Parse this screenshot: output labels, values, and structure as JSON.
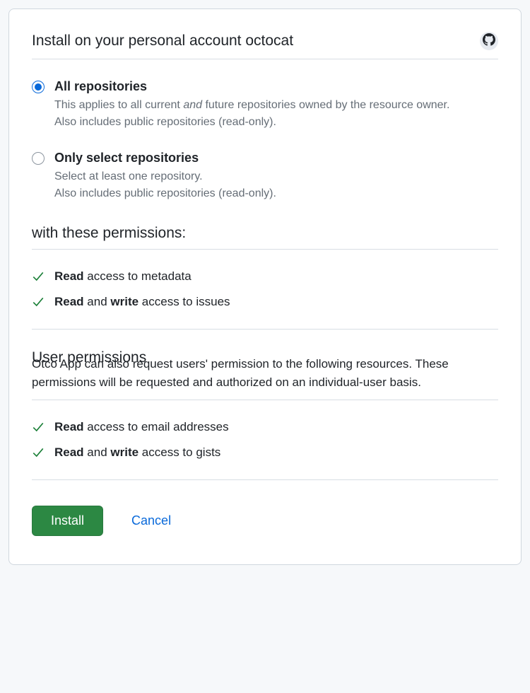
{
  "header": {
    "title": "Install on your personal account octocat"
  },
  "repo_selection": {
    "all": {
      "title": "All repositories",
      "desc_pre": "This applies to all current ",
      "desc_em": "and",
      "desc_post": " future repositories owned by the resource owner.",
      "desc_extra": "Also includes public repositories (read-only).",
      "selected": true
    },
    "select": {
      "title": "Only select repositories",
      "desc_line1": "Select at least one repository.",
      "desc_line2": "Also includes public repositories (read-only).",
      "selected": false
    }
  },
  "permissions": {
    "heading": "with these permissions:",
    "items": [
      {
        "bold1": "Read",
        "text1": " access to metadata"
      },
      {
        "bold1": "Read",
        "text1": " and ",
        "bold2": "write",
        "text2": " access to issues"
      }
    ]
  },
  "user_permissions": {
    "heading": "User permissions",
    "subtext": "Otco App can also request users' permission to the following resources. These permissions will be requested and authorized on an individual-user basis.",
    "items": [
      {
        "bold1": "Read",
        "text1": " access to email addresses"
      },
      {
        "bold1": "Read",
        "text1": " and ",
        "bold2": "write",
        "text2": " access to gists"
      }
    ]
  },
  "actions": {
    "install": "Install",
    "cancel": "Cancel"
  }
}
